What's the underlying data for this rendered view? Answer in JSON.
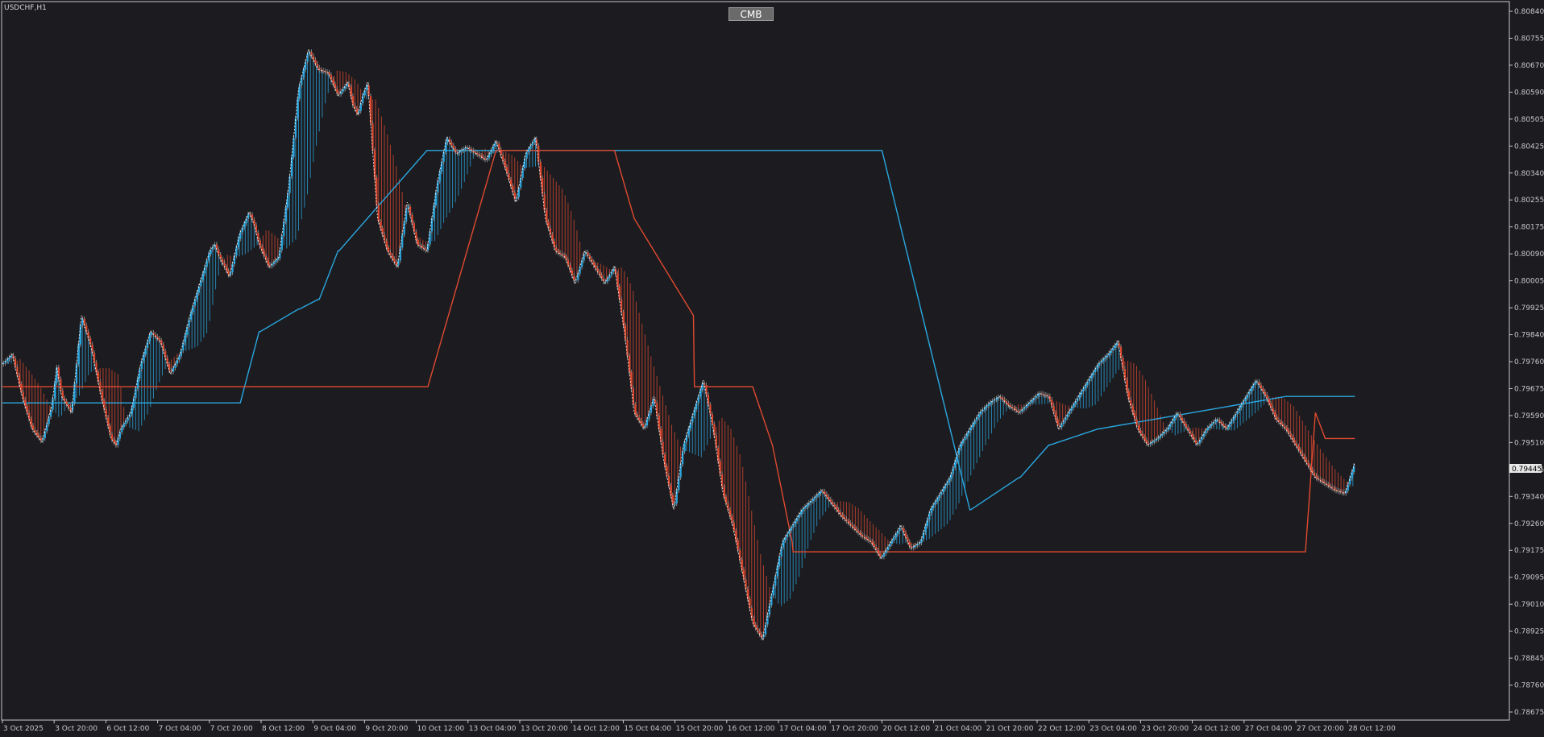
{
  "chart_title": "USDCHF,H1",
  "badge_label": "CMB",
  "colors": {
    "background": "#1c1c20",
    "bull": "#2aa7e0",
    "bear": "#e0492f",
    "upper_band": "#e0492f",
    "lower_band": "#2aa7e0",
    "axis": "#c8c8c8"
  },
  "chart_data": {
    "type": "line",
    "ylim": [
      0.78675,
      0.8084
    ],
    "y_ticks": [
      "0.80840",
      "0.80755",
      "0.80670",
      "0.80590",
      "0.80505",
      "0.80425",
      "0.80340",
      "0.80255",
      "0.80175",
      "0.80090",
      "0.80005",
      "0.79925",
      "0.79840",
      "0.79760",
      "0.79675",
      "0.79590",
      "0.79510",
      "0.79425",
      "0.79340",
      "0.79260",
      "0.79175",
      "0.79095",
      "0.79010",
      "0.78925",
      "0.78845",
      "0.78760",
      "0.78675"
    ],
    "x_ticks": [
      "3 Oct 2025",
      "3 Oct 20:00",
      "6 Oct 12:00",
      "7 Oct 04:00",
      "7 Oct 20:00",
      "8 Oct 12:00",
      "9 Oct 04:00",
      "9 Oct 20:00",
      "10 Oct 12:00",
      "13 Oct 04:00",
      "13 Oct 20:00",
      "14 Oct 12:00",
      "15 Oct 04:00",
      "15 Oct 20:00",
      "16 Oct 12:00",
      "17 Oct 04:00",
      "17 Oct 20:00",
      "20 Oct 12:00",
      "21 Oct 04:00",
      "21 Oct 20:00",
      "22 Oct 12:00",
      "23 Oct 04:00",
      "23 Oct 20:00",
      "24 Oct 12:00",
      "27 Oct 04:00",
      "27 Oct 20:00",
      "28 Oct 12:00"
    ],
    "current_price": "0.79445",
    "series": [
      {
        "name": "",
        "x_bar": [
          0,
          10,
          20,
          30,
          40,
          50,
          55,
          60,
          70,
          80,
          90,
          100,
          110,
          115,
          120,
          130,
          140,
          150,
          160,
          170,
          180,
          190,
          200,
          205,
          210,
          215,
          220,
          230,
          240,
          250,
          255,
          260,
          270,
          280,
          290,
          300,
          310,
          320,
          330,
          340,
          350,
          355,
          360,
          365,
          370,
          380,
          390,
          400,
          410,
          420,
          430,
          440,
          450,
          460,
          470,
          480,
          490,
          500,
          510,
          520,
          530,
          540,
          550,
          560,
          570,
          580,
          590,
          600,
          610,
          620,
          630,
          640,
          650,
          660,
          670,
          680,
          690,
          700,
          710,
          720,
          730,
          740,
          750,
          760,
          770,
          780,
          790,
          800,
          810,
          820,
          830,
          840,
          850,
          860,
          870,
          880,
          890,
          900,
          910,
          920,
          930,
          940,
          950,
          960,
          970,
          980,
          990,
          1000,
          1010,
          1020,
          1030,
          1040,
          1050,
          1060,
          1070,
          1080,
          1090,
          1100,
          1110,
          1120,
          1130,
          1140,
          1150,
          1160,
          1170,
          1180,
          1190,
          1200,
          1210,
          1220,
          1230,
          1240,
          1250,
          1260,
          1270,
          1280,
          1290,
          1300,
          1310,
          1320,
          1330,
          1340,
          1350,
          1360,
          1370
        ],
        "close": [
          0.7975,
          0.7978,
          0.7965,
          0.7955,
          0.7951,
          0.7962,
          0.7974,
          0.7965,
          0.796,
          0.799,
          0.798,
          0.7965,
          0.7952,
          0.795,
          0.7955,
          0.796,
          0.7975,
          0.7985,
          0.7982,
          0.7972,
          0.7978,
          0.799,
          0.8,
          0.8005,
          0.801,
          0.8012,
          0.8008,
          0.8002,
          0.8015,
          0.8022,
          0.8018,
          0.8012,
          0.8005,
          0.8008,
          0.803,
          0.806,
          0.8072,
          0.8066,
          0.8065,
          0.8058,
          0.8062,
          0.8055,
          0.8052,
          0.8058,
          0.8062,
          0.802,
          0.801,
          0.8005,
          0.8025,
          0.8012,
          0.801,
          0.803,
          0.8045,
          0.804,
          0.8042,
          0.804,
          0.8038,
          0.8044,
          0.8035,
          0.8025,
          0.804,
          0.8045,
          0.802,
          0.801,
          0.8008,
          0.8,
          0.801,
          0.8005,
          0.8,
          0.8005,
          0.7985,
          0.796,
          0.7955,
          0.7965,
          0.7945,
          0.793,
          0.795,
          0.796,
          0.797,
          0.7955,
          0.7935,
          0.7925,
          0.791,
          0.7895,
          0.789,
          0.7905,
          0.792,
          0.7925,
          0.793,
          0.7933,
          0.7936,
          0.7932,
          0.7928,
          0.7925,
          0.7922,
          0.792,
          0.7915,
          0.792,
          0.7925,
          0.7918,
          0.792,
          0.793,
          0.7935,
          0.794,
          0.795,
          0.7955,
          0.796,
          0.7963,
          0.7965,
          0.7962,
          0.796,
          0.7963,
          0.7966,
          0.7965,
          0.7955,
          0.796,
          0.7965,
          0.797,
          0.7975,
          0.7978,
          0.7982,
          0.7965,
          0.7955,
          0.795,
          0.7952,
          0.7955,
          0.796,
          0.7955,
          0.795,
          0.7955,
          0.7958,
          0.7955,
          0.796,
          0.7965,
          0.797,
          0.7965,
          0.7958,
          0.7955,
          0.795,
          0.7945,
          0.794,
          0.7938,
          0.7936,
          0.7935,
          0.79445
        ]
      },
      {
        "name": "",
        "x_bar": [
          0,
          180,
          181,
          240,
          241,
          260,
          261,
          300,
          301,
          320,
          321,
          340,
          341,
          430,
          431,
          500,
          501,
          620,
          621,
          680,
          681,
          780,
          781,
          830,
          831,
          890,
          891,
          980,
          981,
          1030,
          1031,
          1060,
          1061,
          1110,
          1111,
          1300,
          1301,
          1340,
          1341,
          1370
        ],
        "values": [
          0.7963,
          0.7963,
          0.7963,
          0.7963,
          0.7963,
          0.7985,
          0.7985,
          0.7992,
          0.7992,
          0.7995,
          0.7995,
          0.801,
          0.801,
          0.8041,
          0.8041,
          0.8041,
          0.8041,
          0.8041,
          0.8041,
          0.8041,
          0.8041,
          0.8041,
          0.8041,
          0.8041,
          0.8041,
          0.8041,
          0.8041,
          0.793,
          0.793,
          0.794,
          0.794,
          0.795,
          0.795,
          0.7955,
          0.7955,
          0.7965,
          0.7965,
          0.7965,
          0.7965,
          0.7965
        ]
      },
      {
        "name": "",
        "x_bar": [
          0,
          300,
          301,
          430,
          431,
          500,
          501,
          600,
          601,
          620,
          640,
          660,
          680,
          700,
          701,
          760,
          780,
          800,
          801,
          900,
          901,
          980,
          981,
          1100,
          1101,
          1320,
          1330,
          1340,
          1341,
          1370
        ],
        "values": [
          0.7968,
          0.7968,
          0.7968,
          0.7968,
          0.7968,
          0.8041,
          0.8041,
          0.8041,
          0.8041,
          0.8041,
          0.802,
          0.801,
          0.8,
          0.799,
          0.7968,
          0.7968,
          0.795,
          0.792,
          0.7917,
          0.7917,
          0.7917,
          0.7917,
          0.7917,
          0.7917,
          0.7917,
          0.7917,
          0.796,
          0.7952,
          0.7952,
          0.7952
        ]
      }
    ]
  }
}
